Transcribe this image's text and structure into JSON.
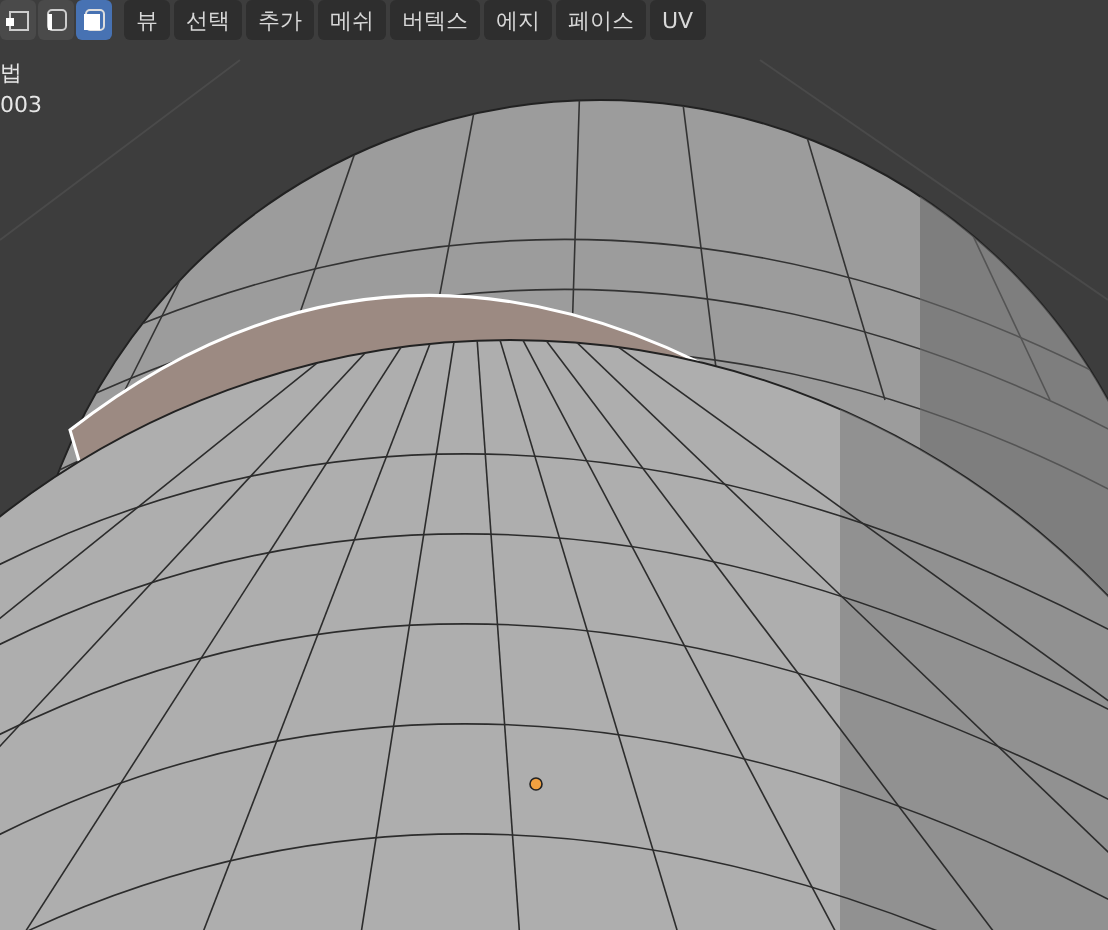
{
  "select_modes": [
    {
      "kind": "vertex",
      "selected": false
    },
    {
      "kind": "edge",
      "selected": false
    },
    {
      "kind": "face",
      "selected": true
    }
  ],
  "menu": [
    "뷰",
    "선택",
    "추가",
    "메쉬",
    "버텍스",
    "에지",
    "페이스",
    "UV"
  ],
  "overlay_text": [
    "법",
    "003"
  ]
}
